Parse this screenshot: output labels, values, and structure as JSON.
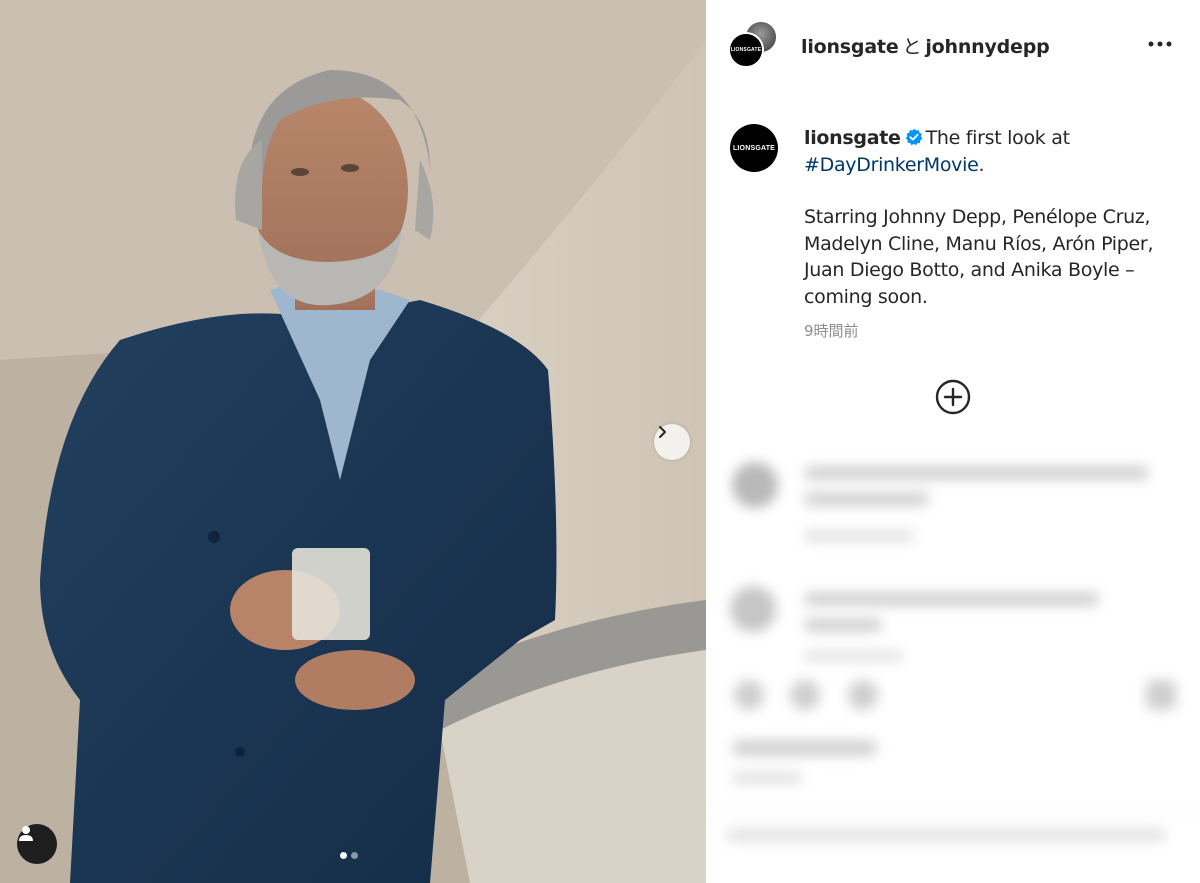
{
  "post": {
    "header": {
      "user1": "lionsgate",
      "joiner": "と",
      "user2": "johnnydepp",
      "logo_text": "LIONSGATE"
    },
    "caption": {
      "username": "lionsgate",
      "line1_text": "The first look at",
      "hashtag": "#DayDrinkerMovie",
      "hashtag_suffix": ".",
      "body": "Starring Johnny Depp, Penélope Cruz, Madelyn Cline, Manu Ríos, Arón Piper, Juan Diego Botto, and Anika Boyle – coming soon."
    },
    "timestamp": "9時間前",
    "carousel": {
      "total": 2,
      "current": 1
    }
  },
  "colors": {
    "hashtag": "#00376b",
    "verified": "#0095f6",
    "muted": "#8e8e8e",
    "text": "#262626"
  },
  "icons": [
    "more-icon",
    "verified-badge-icon",
    "add-comment-icon",
    "chevron-right-icon",
    "user-tag-icon"
  ]
}
